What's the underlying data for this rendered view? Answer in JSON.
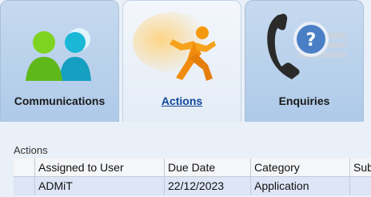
{
  "tabs": [
    {
      "label": "Communications",
      "icon": "users-icon",
      "active": false
    },
    {
      "label": "Actions",
      "icon": "running-man-icon",
      "active": true
    },
    {
      "label": "Enquiries",
      "icon": "phone-question-icon",
      "active": false
    }
  ],
  "section": {
    "title": "Actions"
  },
  "table": {
    "columns": [
      "",
      "Assigned to User",
      "Due Date",
      "Category",
      "Subje"
    ],
    "rows": [
      [
        "",
        "ADMiT",
        "22/12/2023",
        "Application",
        ""
      ]
    ]
  },
  "colors": {
    "tab_bg": "#b7cfea",
    "active_tab_bg": "#eef3f9",
    "selected_row": "#dde5f6"
  }
}
